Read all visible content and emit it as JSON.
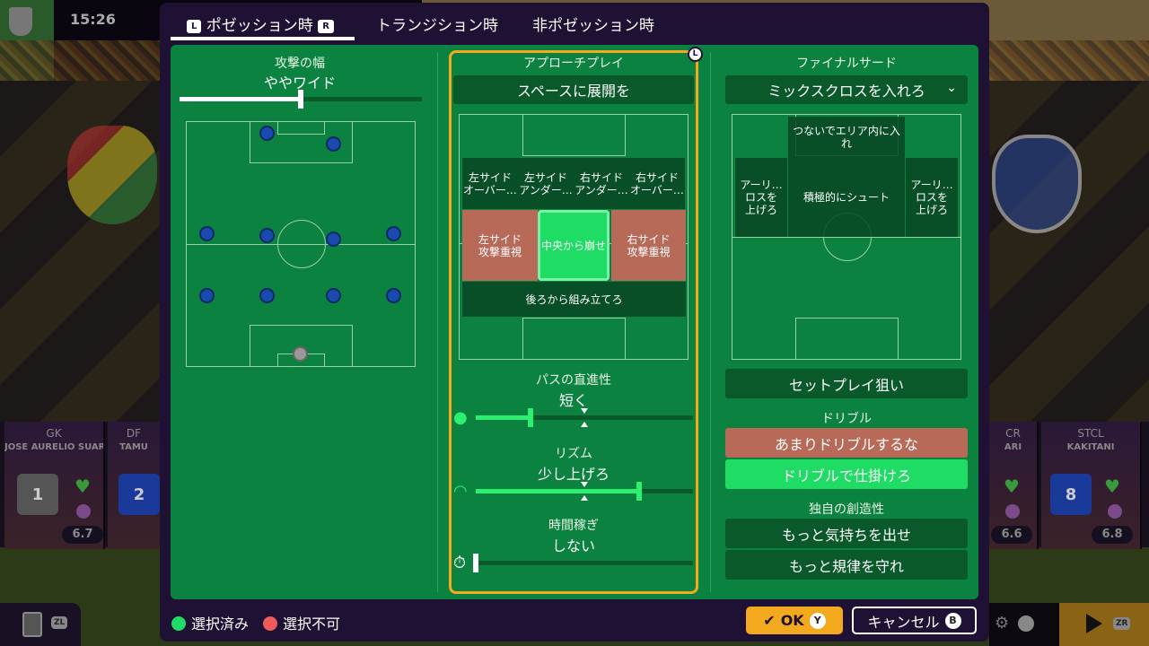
{
  "hud": {
    "clock": "15:26"
  },
  "tabs": [
    {
      "label": "ポゼッション時",
      "key_left": "L",
      "key_right": "R",
      "active": true
    },
    {
      "label": "トランジション時"
    },
    {
      "label": "非ポゼッション時"
    }
  ],
  "left": {
    "title": "攻撃の幅",
    "value": "ややワイド",
    "slider_percent": 50
  },
  "middle": {
    "title": "アプローチプレイ",
    "key": "L",
    "dropdown": "スペースに展開を",
    "zones": {
      "top": [
        "左サイド\nオーバー…",
        "左サイド\nアンダー…",
        "右サイド\nアンダー…",
        "右サイド\nオーバー…"
      ],
      "left": "左サイド\n攻撃重視",
      "center": "中央から崩せ",
      "right": "右サイド\n攻撃重視",
      "bottom": "後ろから組み立てろ"
    },
    "sliders": [
      {
        "title": "パスの直進性",
        "value": "短く",
        "percent": 25,
        "icon": "soccer-ball-icon"
      },
      {
        "title": "リズム",
        "value": "少し上げろ",
        "percent": 75,
        "icon": "speedometer-icon"
      },
      {
        "title": "時間稼ぎ",
        "value": "しない",
        "percent": 0,
        "icon": "stopwatch-icon"
      }
    ]
  },
  "right": {
    "title": "ファイナルサード",
    "dropdown": "ミックスクロスを入れろ",
    "zones": {
      "top": "つないでエリア内に入れ",
      "left": "アーリ…\nロスを\n上げろ",
      "center": "積極的にシュート",
      "right": "アーリ…\nロスを\n上げろ"
    },
    "setplay": "セットプレイ狙い",
    "dribble_title": "ドリブル",
    "dribble_options": [
      "あまりドリブルするな",
      "ドリブルで仕掛けろ"
    ],
    "creativity_title": "独自の創造性",
    "creativity_options": [
      "もっと気持ちを出せ",
      "もっと規律を守れ"
    ]
  },
  "legend": {
    "selected": "選択済み",
    "unavailable": "選択不可",
    "selected_color": "#1fdc64",
    "unavailable_color": "#f05a5a"
  },
  "buttons": {
    "ok": "OK",
    "ok_key": "Y",
    "cancel": "キャンセル",
    "cancel_key": "B",
    "zl": "ZL",
    "zr": "ZR"
  },
  "players": [
    {
      "pos": "GK",
      "name": "JOSE AURELIO SUAREZ",
      "number": "1",
      "rating": "6.7"
    },
    {
      "pos": "DF",
      "name": "TAMU",
      "number": "2"
    },
    {
      "pos": "CR",
      "name": "ARI",
      "rating": "6.6"
    },
    {
      "pos": "STCL",
      "name": "KAKITANI",
      "number": "8",
      "rating": "6.8"
    }
  ],
  "colors": {
    "panel": "#0c8240",
    "modal": "#1f1133",
    "accent": "#f2a91e",
    "selected": "#1fdc64",
    "rejected": "#b86a58"
  }
}
